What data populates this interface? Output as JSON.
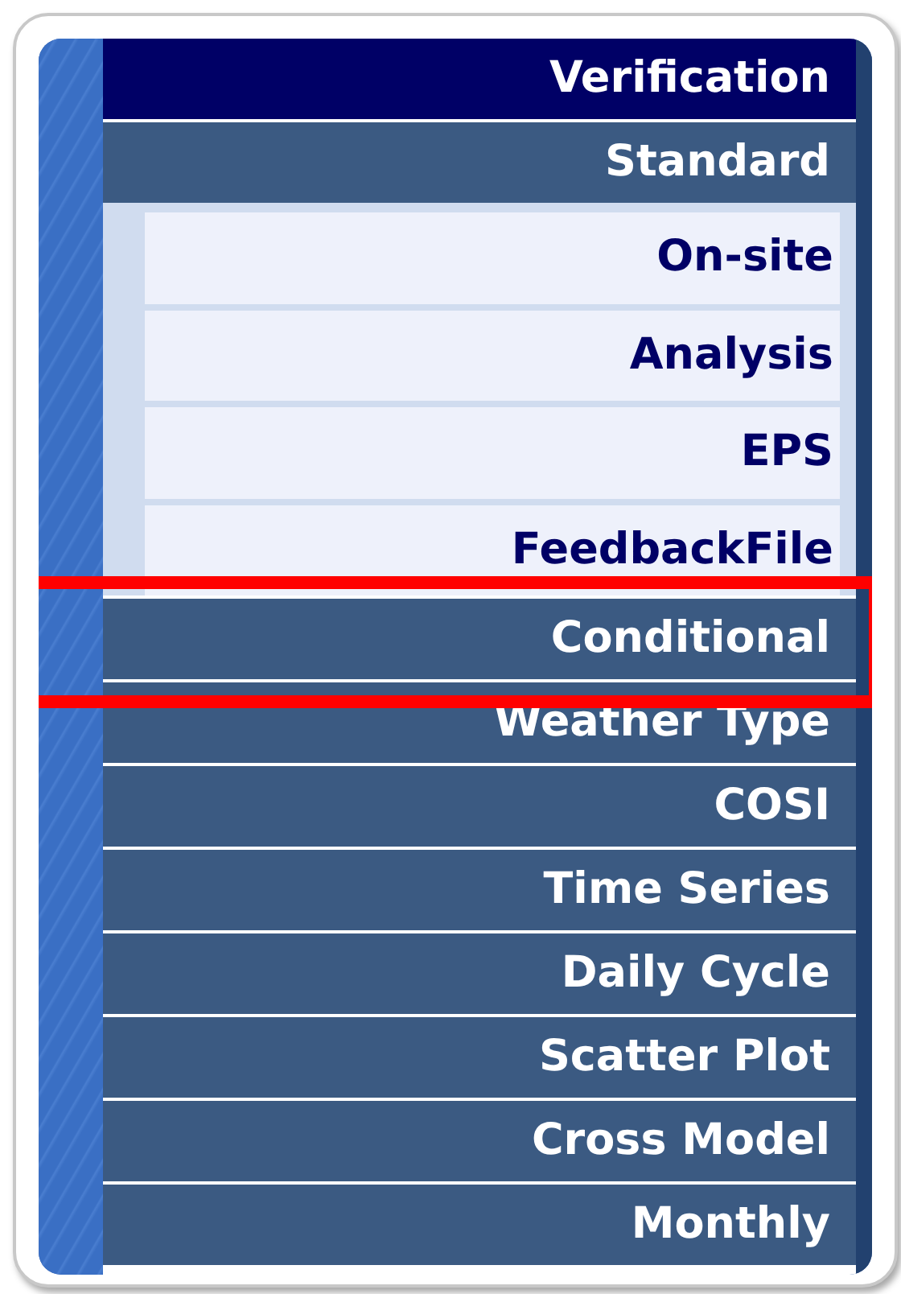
{
  "menu": {
    "title": "Verification",
    "items": [
      {
        "label": "Standard",
        "expanded": true,
        "highlighted": false,
        "children": [
          {
            "label": "On-site"
          },
          {
            "label": "Analysis"
          },
          {
            "label": "EPS"
          },
          {
            "label": "FeedbackFile"
          }
        ]
      },
      {
        "label": "Conditional",
        "highlighted": true
      },
      {
        "label": "Weather Type",
        "highlighted": false
      },
      {
        "label": "COSI",
        "highlighted": false
      },
      {
        "label": "Time Series",
        "highlighted": false
      },
      {
        "label": "Daily Cycle",
        "highlighted": false
      },
      {
        "label": "Scatter Plot",
        "highlighted": false
      },
      {
        "label": "Cross Model",
        "highlighted": false
      },
      {
        "label": "Monthly",
        "highlighted": false
      }
    ]
  }
}
